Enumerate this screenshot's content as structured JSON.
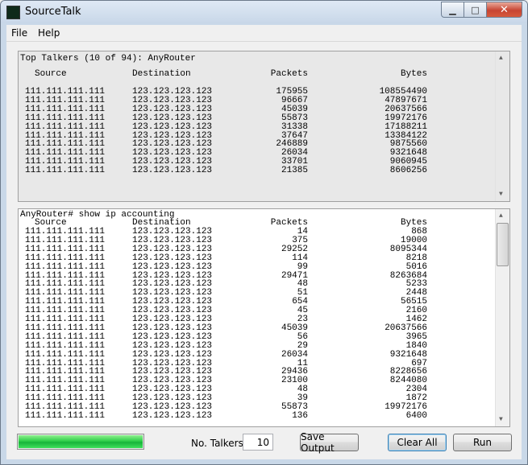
{
  "window": {
    "title": "SourceTalk",
    "minimize_glyph": "▁",
    "maximize_glyph": "□",
    "close_glyph": "✕"
  },
  "menu": {
    "file": "File",
    "help": "Help"
  },
  "top_pane": {
    "summary": "Top Talkers (10 of 94): AnyRouter",
    "columns": {
      "source": "Source",
      "destination": "Destination",
      "packets": "Packets",
      "bytes": "Bytes"
    },
    "rows": [
      [
        "111.111.111.111",
        "123.123.123.123",
        "175955",
        "108554490"
      ],
      [
        "111.111.111.111",
        "123.123.123.123",
        "96667",
        "47897671"
      ],
      [
        "111.111.111.111",
        "123.123.123.123",
        "45039",
        "20637566"
      ],
      [
        "111.111.111.111",
        "123.123.123.123",
        "55873",
        "19972176"
      ],
      [
        "111.111.111.111",
        "123.123.123.123",
        "31338",
        "17188211"
      ],
      [
        "111.111.111.111",
        "123.123.123.123",
        "37647",
        "13384122"
      ],
      [
        "111.111.111.111",
        "123.123.123.123",
        "246889",
        "9875560"
      ],
      [
        "111.111.111.111",
        "123.123.123.123",
        "26034",
        "9321648"
      ],
      [
        "111.111.111.111",
        "123.123.123.123",
        "33701",
        "9060945"
      ],
      [
        "111.111.111.111",
        "123.123.123.123",
        "21385",
        "8606256"
      ]
    ]
  },
  "bottom_pane": {
    "command": "AnyRouter# show ip accounting",
    "columns": {
      "source": "Source",
      "destination": "Destination",
      "packets": "Packets",
      "bytes": "Bytes"
    },
    "rows": [
      [
        "111.111.111.111",
        "123.123.123.123",
        "14",
        "868"
      ],
      [
        "111.111.111.111",
        "123.123.123.123",
        "375",
        "19000"
      ],
      [
        "111.111.111.111",
        "123.123.123.123",
        "29252",
        "8095344"
      ],
      [
        "111.111.111.111",
        "123.123.123.123",
        "114",
        "8218"
      ],
      [
        "111.111.111.111",
        "123.123.123.123",
        "99",
        "5016"
      ],
      [
        "111.111.111.111",
        "123.123.123.123",
        "29471",
        "8263684"
      ],
      [
        "111.111.111.111",
        "123.123.123.123",
        "48",
        "5233"
      ],
      [
        "111.111.111.111",
        "123.123.123.123",
        "51",
        "2448"
      ],
      [
        "111.111.111.111",
        "123.123.123.123",
        "654",
        "56515"
      ],
      [
        "111.111.111.111",
        "123.123.123.123",
        "45",
        "2160"
      ],
      [
        "111.111.111.111",
        "123.123.123.123",
        "23",
        "1462"
      ],
      [
        "111.111.111.111",
        "123.123.123.123",
        "45039",
        "20637566"
      ],
      [
        "111.111.111.111",
        "123.123.123.123",
        "56",
        "3965"
      ],
      [
        "111.111.111.111",
        "123.123.123.123",
        "29",
        "1840"
      ],
      [
        "111.111.111.111",
        "123.123.123.123",
        "26034",
        "9321648"
      ],
      [
        "111.111.111.111",
        "123.123.123.123",
        "11",
        "697"
      ],
      [
        "111.111.111.111",
        "123.123.123.123",
        "29436",
        "8228656"
      ],
      [
        "111.111.111.111",
        "123.123.123.123",
        "23100",
        "8244080"
      ],
      [
        "111.111.111.111",
        "123.123.123.123",
        "48",
        "2304"
      ],
      [
        "111.111.111.111",
        "123.123.123.123",
        "39",
        "1872"
      ],
      [
        "111.111.111.111",
        "123.123.123.123",
        "55873",
        "19972176"
      ],
      [
        "111.111.111.111",
        "123.123.123.123",
        "136",
        "6400"
      ]
    ]
  },
  "controls": {
    "progress_fraction": 1.0,
    "progress_color": "#2fcf4a",
    "talkers_label": "No. Talkers",
    "talkers_value": "10",
    "save_label": "Save Output",
    "clear_label": "Clear All",
    "run_label": "Run"
  },
  "icons": {
    "scroll_up": "▲",
    "scroll_down": "▼"
  }
}
